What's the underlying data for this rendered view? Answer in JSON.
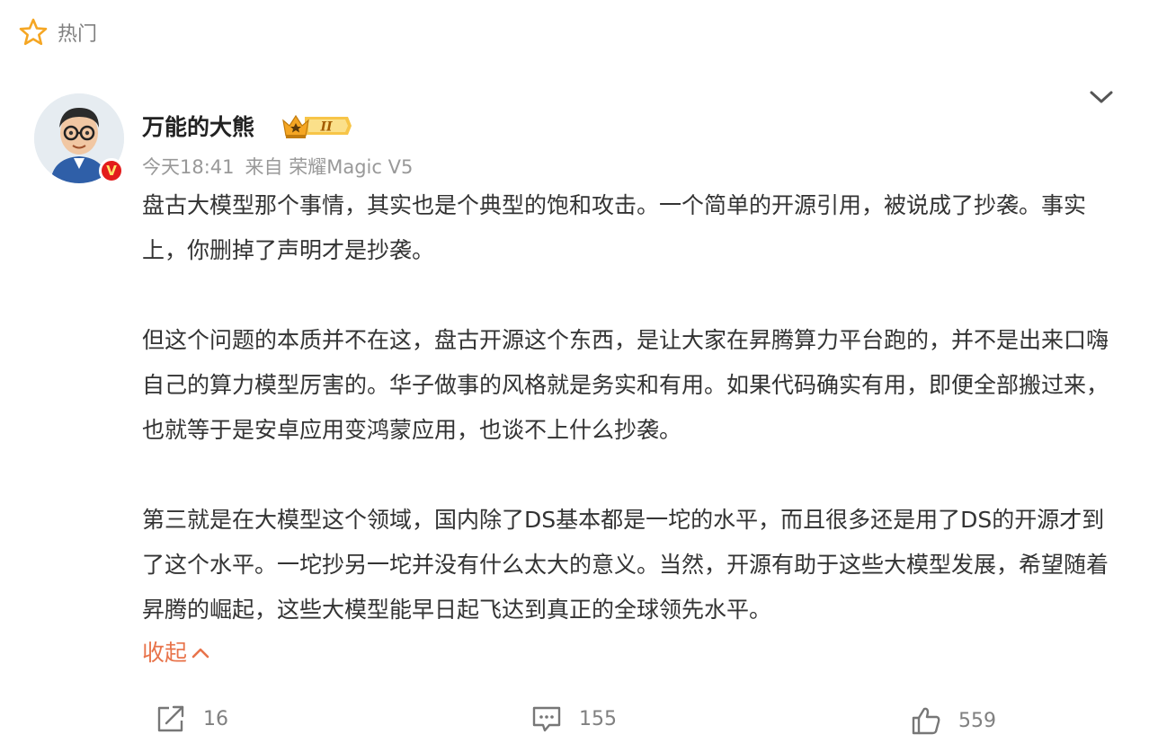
{
  "header": {
    "hot_label": "热门",
    "icon": "star-icon"
  },
  "post": {
    "author": "万能的大熊",
    "verified_badge": "V",
    "level_badge": "II",
    "time": "今天18:41",
    "source": "来自 荣耀Magic V5",
    "paragraphs": [
      "盘古大模型那个事情，其实也是个典型的饱和攻击。一个简单的开源引用，被说成了抄袭。事实上，你删掉了声明才是抄袭。",
      "但这个问题的本质并不在这，盘古开源这个东西，是让大家在昇腾算力平台跑的，并不是出来口嗨自己的算力模型厉害的。华子做事的风格就是务实和有用。如果代码确实有用，即便全部搬过来，也就等于是安卓应用变鸿蒙应用，也谈不上什么抄袭。",
      "第三就是在大模型这个领域，国内除了DS基本都是一坨的水平，而且很多还是用了DS的开源才到了这个水平。一坨抄另一坨并没有什么太大的意义。当然，开源有助于这些大模型发展，希望随着昇腾的崛起，这些大模型能早日起飞达到真正的全球领先水平。"
    ],
    "collapse_label": "收起"
  },
  "actions": {
    "share": {
      "icon": "share-icon",
      "count": "16"
    },
    "comment": {
      "icon": "comment-icon",
      "count": "155"
    },
    "like": {
      "icon": "thumbs-up-icon",
      "count": "559"
    }
  },
  "colors": {
    "accent": "#e8734a",
    "star": "#f5a623",
    "verified": "#e31c1c"
  }
}
